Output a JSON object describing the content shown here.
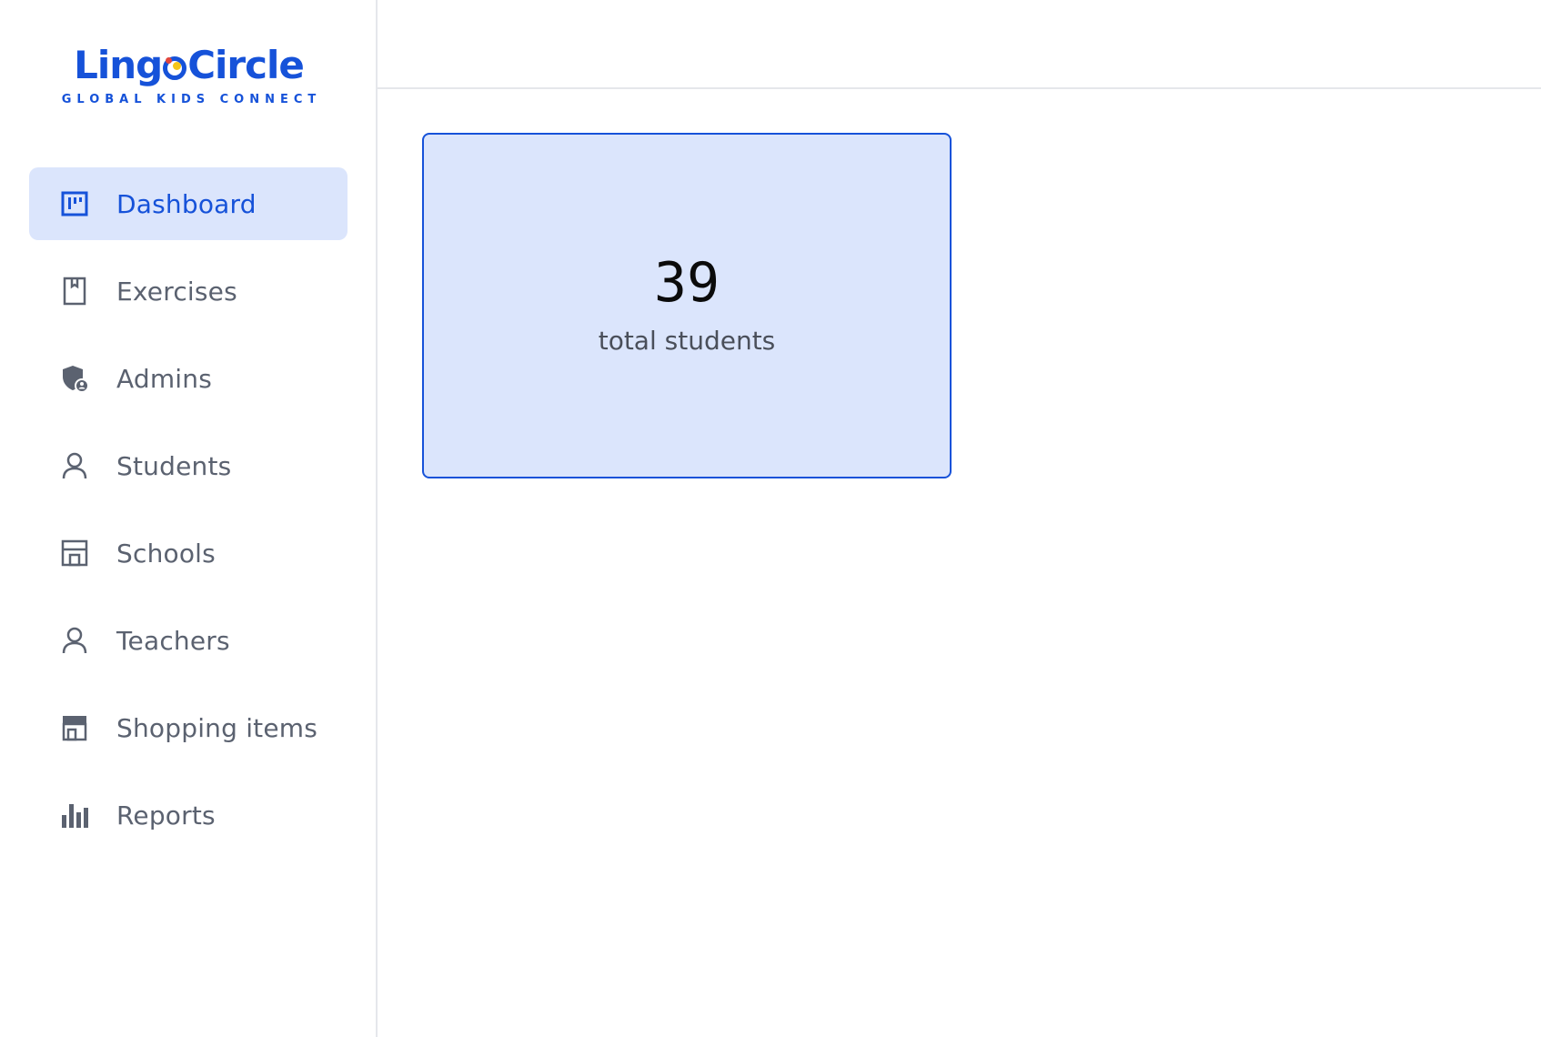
{
  "brand": {
    "name_part1": "Ling",
    "name_part2": "Circle",
    "tagline": "GLOBAL KIDS CONNECT",
    "color": "#1652d9"
  },
  "sidebar": {
    "items": [
      {
        "label": "Dashboard",
        "icon": "dashboard-icon",
        "active": true
      },
      {
        "label": "Exercises",
        "icon": "book-icon",
        "active": false
      },
      {
        "label": "Admins",
        "icon": "shield-user-icon",
        "active": false
      },
      {
        "label": "Students",
        "icon": "user-icon",
        "active": false
      },
      {
        "label": "Schools",
        "icon": "storefront-icon",
        "active": false
      },
      {
        "label": "Teachers",
        "icon": "user-icon",
        "active": false
      },
      {
        "label": "Shopping items",
        "icon": "store-icon",
        "active": false
      },
      {
        "label": "Reports",
        "icon": "bar-chart-icon",
        "active": false
      }
    ],
    "active_bg": "#dbe5fc",
    "active_color": "#1652d9",
    "inactive_color": "#5b6270"
  },
  "main": {
    "stat_card": {
      "value": "39",
      "label": "total students"
    }
  }
}
